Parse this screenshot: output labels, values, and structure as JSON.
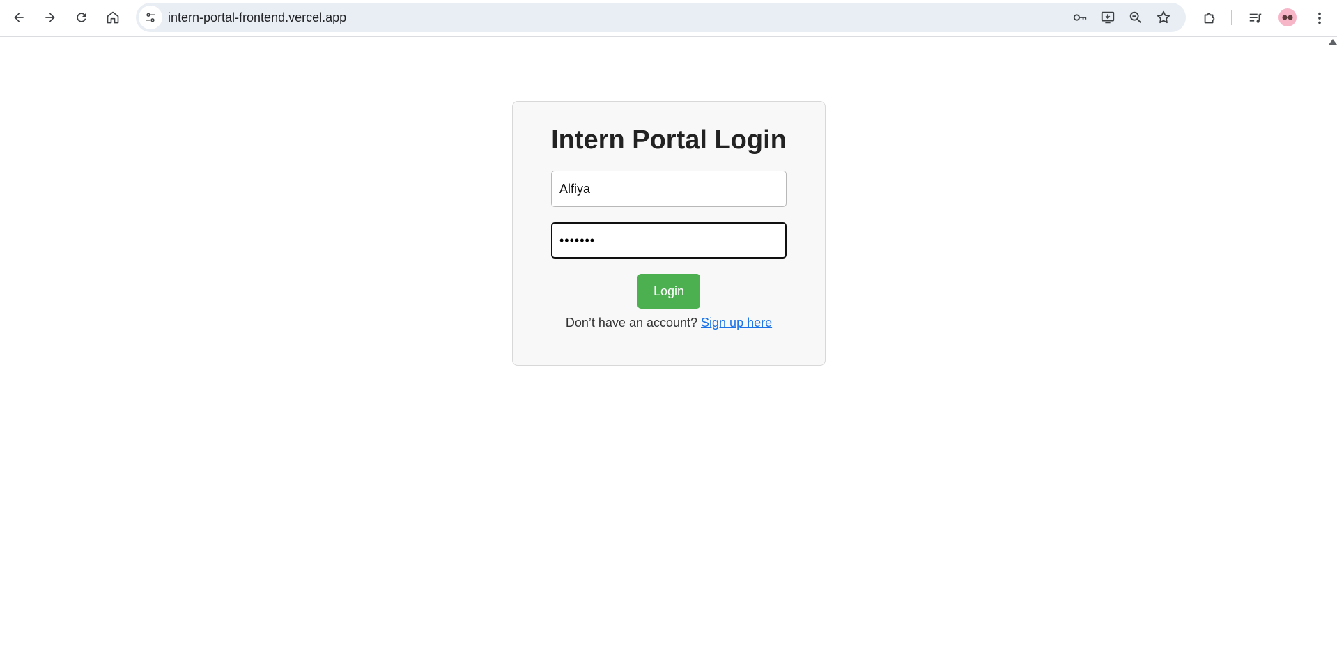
{
  "browser": {
    "url": "intern-portal-frontend.vercel.app",
    "icons": {
      "back": "arrow-left-icon",
      "forward": "arrow-right-icon",
      "reload": "reload-icon",
      "home": "home-icon",
      "site_info": "tune-icon",
      "password": "key-icon",
      "install": "install-app-icon",
      "zoom": "zoom-out-icon",
      "bookmark": "star-icon",
      "extensions": "puzzle-icon",
      "media": "playlist-icon",
      "profile": "avatar-icon",
      "menu": "more-vert-icon"
    }
  },
  "login": {
    "title": "Intern Portal Login",
    "username_value": "Alfiya",
    "password_masked": "•••••••",
    "button_label": "Login",
    "signup_prompt": "Don’t have an account? ",
    "signup_link": "Sign up here"
  },
  "colors": {
    "button": "#4caf50",
    "link": "#1a73e8",
    "card_bg": "#f8f8f8"
  }
}
